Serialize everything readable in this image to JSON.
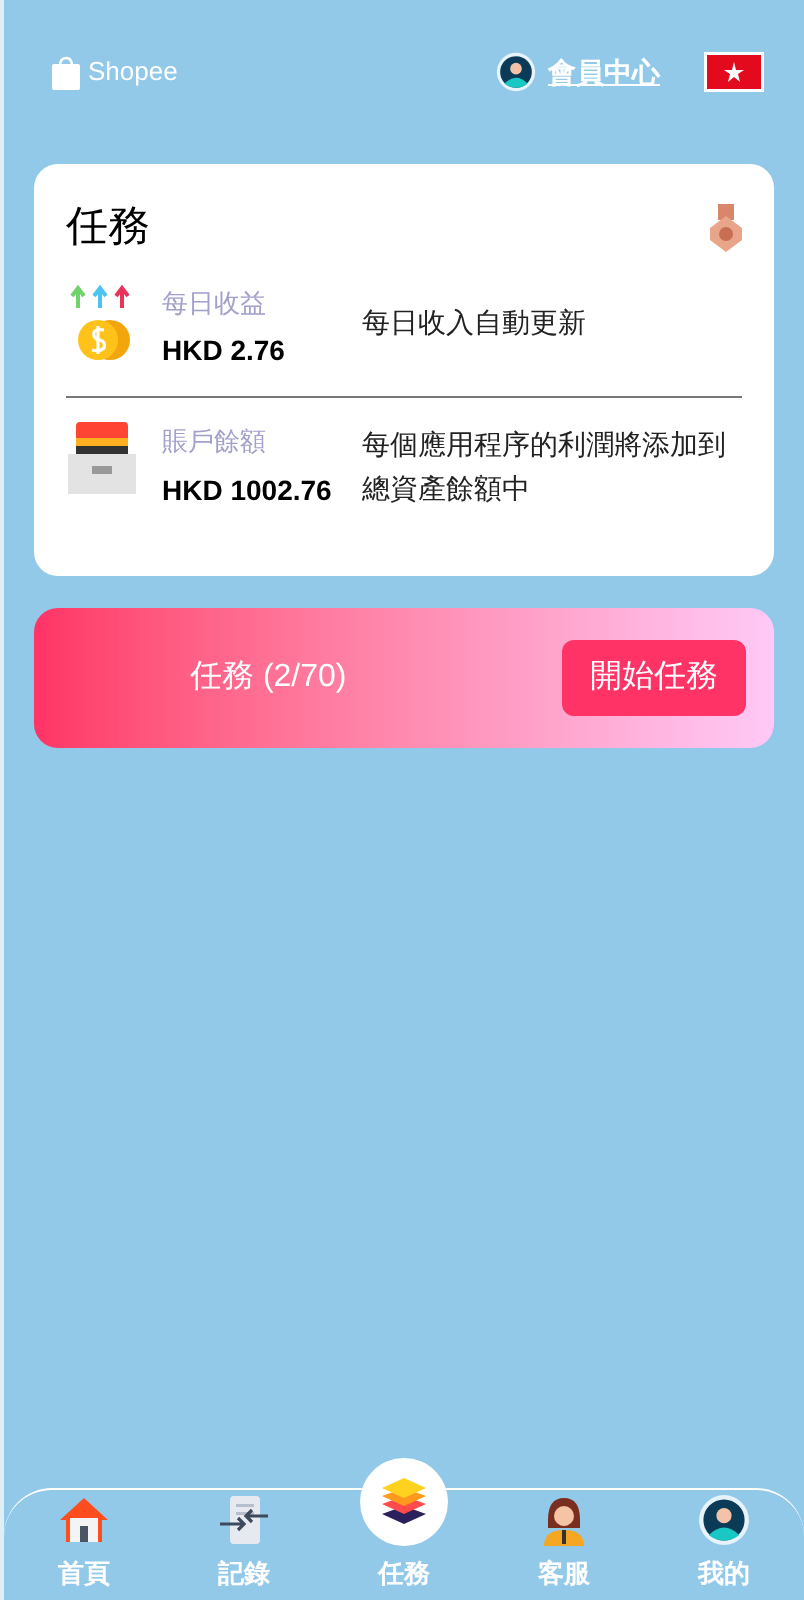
{
  "header": {
    "brand": "Shopee",
    "member_link": "會員中心"
  },
  "task_card": {
    "title": "任務",
    "stats": [
      {
        "kind": "coins",
        "label": "每日收益",
        "value": "HKD 2.76",
        "note": "每日收入自動更新"
      },
      {
        "kind": "drawer",
        "label": "賬戶餘額",
        "value": "HKD 1002.76",
        "note": "每個應用程序的利潤將添加到總資產餘額中"
      }
    ]
  },
  "task_bar": {
    "progress": "任務 (2/70)",
    "start_button": "開始任務"
  },
  "nav": [
    {
      "kind": "home",
      "label": "首頁",
      "selected": false
    },
    {
      "kind": "records",
      "label": "記錄",
      "selected": false
    },
    {
      "kind": "tasks",
      "label": "任務",
      "selected": true
    },
    {
      "kind": "service",
      "label": "客服",
      "selected": false
    },
    {
      "kind": "profile",
      "label": "我的",
      "selected": false
    }
  ]
}
